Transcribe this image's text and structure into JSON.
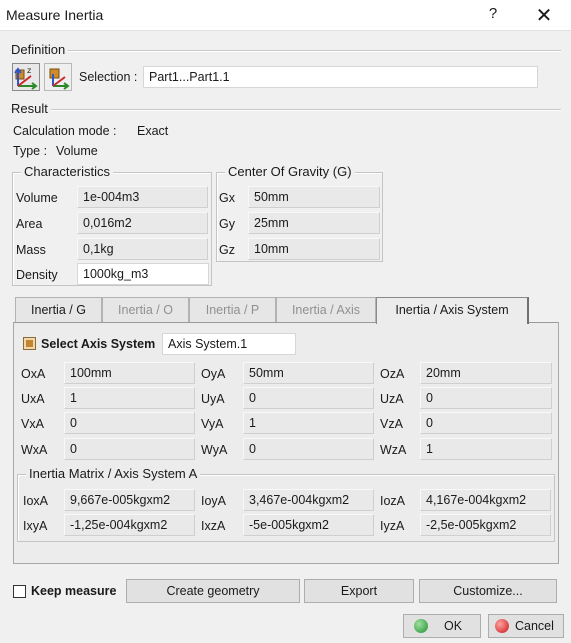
{
  "window": {
    "title": "Measure Inertia",
    "help": "?",
    "close": "✕"
  },
  "definition": {
    "label": "Definition",
    "selection_label": "Selection :",
    "selection_value": "Part1...Part1.1"
  },
  "result": {
    "label": "Result",
    "calc_mode_label": "Calculation mode :",
    "calc_mode_value": "Exact",
    "type_label": "Type :",
    "type_value": "Volume"
  },
  "characteristics": {
    "label": "Characteristics",
    "rows": [
      {
        "label": "Volume",
        "value": "1e-004m3"
      },
      {
        "label": "Area",
        "value": "0,016m2"
      },
      {
        "label": "Mass",
        "value": "0,1kg"
      },
      {
        "label": "Density",
        "value": "1000kg_m3"
      }
    ]
  },
  "cog": {
    "label": "Center Of Gravity (G)",
    "rows": [
      {
        "label": "Gx",
        "value": "50mm"
      },
      {
        "label": "Gy",
        "value": "25mm"
      },
      {
        "label": "Gz",
        "value": "10mm"
      }
    ]
  },
  "tabs": [
    {
      "label": "Inertia / G"
    },
    {
      "label": "Inertia / O"
    },
    {
      "label": "Inertia / P"
    },
    {
      "label": "Inertia / Axis"
    },
    {
      "label": "Inertia / Axis System"
    }
  ],
  "axis_system": {
    "select_label": "Select Axis System",
    "select_value": "Axis System.1",
    "rows": [
      [
        {
          "label": "OxA",
          "value": "100mm"
        },
        {
          "label": "OyA",
          "value": "50mm"
        },
        {
          "label": "OzA",
          "value": "20mm"
        }
      ],
      [
        {
          "label": "UxA",
          "value": "1"
        },
        {
          "label": "UyA",
          "value": "0"
        },
        {
          "label": "UzA",
          "value": "0"
        }
      ],
      [
        {
          "label": "VxA",
          "value": "0"
        },
        {
          "label": "VyA",
          "value": "1"
        },
        {
          "label": "VzA",
          "value": "0"
        }
      ],
      [
        {
          "label": "WxA",
          "value": "0"
        },
        {
          "label": "WyA",
          "value": "0"
        },
        {
          "label": "WzA",
          "value": "1"
        }
      ]
    ]
  },
  "inertia_matrix": {
    "label": "Inertia Matrix / Axis System A",
    "rows": [
      [
        {
          "label": "IoxA",
          "value": "9,667e-005kgxm2"
        },
        {
          "label": "IoyA",
          "value": "3,467e-004kgxm2"
        },
        {
          "label": "IozA",
          "value": "4,167e-004kgxm2"
        }
      ],
      [
        {
          "label": "IxyA",
          "value": "-1,25e-004kgxm2"
        },
        {
          "label": "IxzA",
          "value": "-5e-005kgxm2"
        },
        {
          "label": "IyzA",
          "value": "-2,5e-005kgxm2"
        }
      ]
    ]
  },
  "footer": {
    "keep_measure": "Keep measure",
    "create_geometry": "Create geometry",
    "export": "Export",
    "customize": "Customize...",
    "ok": "OK",
    "cancel": "Cancel"
  }
}
